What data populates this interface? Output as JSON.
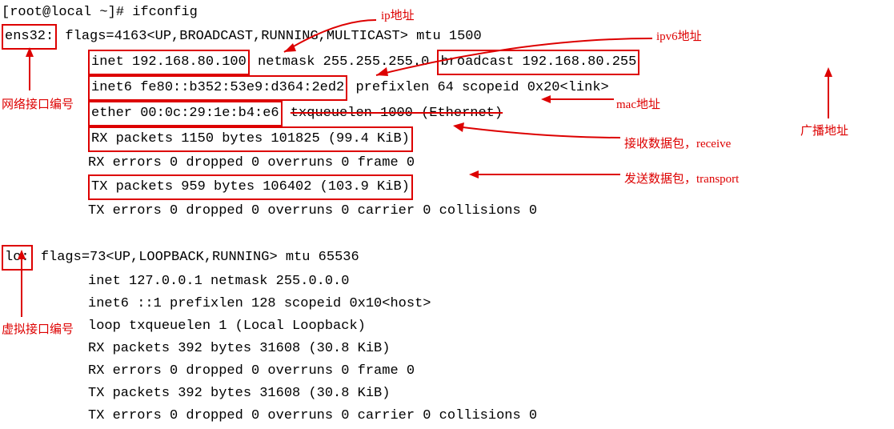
{
  "prompt": "[root@local ~]# ifconfig",
  "ens32": {
    "name": "ens32:",
    "flags": "flags=4163<UP,BROADCAST,RUNNING,MULTICAST>  mtu 1500",
    "inet": "inet 192.168.80.100",
    "netmask": " netmask 255.255.255.0 ",
    "broadcast_prefix": " ",
    "broadcast": "broadcast 192.168.80.255",
    "inet6": "inet6 fe80::b352:53e9:d364:2ed2",
    "inet6_rest": "  prefixlen 64  scopeid 0x20<link>",
    "ether": "ether 00:0c:29:1e:b4:e6",
    "txqueue": "  txqueuelen 1000  (Ethernet)",
    "rx_pkts": "RX packets 1150  bytes 101825 (99.4 KiB)",
    "rx_err": "RX errors 0  dropped 0  overruns 0  frame 0",
    "tx_pkts": "TX packets 959  bytes 106402 (103.9 KiB)",
    "tx_err": "TX errors 0  dropped 0 overruns 0  carrier 0  collisions 0"
  },
  "lo": {
    "name": "lo:",
    "flags": " flags=73<UP,LOOPBACK,RUNNING>  mtu 65536",
    "inet": "inet 127.0.0.1  netmask 255.0.0.0",
    "inet6": "inet6 ::1  prefixlen 128  scopeid 0x10<host>",
    "loop": "loop  txqueuelen 1  (Local Loopback)",
    "rx_pkts": "RX packets 392  bytes 31608 (30.8 KiB)",
    "rx_err": "RX errors 0  dropped 0  overruns 0  frame 0",
    "tx_pkts": "TX packets 392  bytes 31608 (30.8 KiB)",
    "tx_err": "TX errors 0  dropped 0 overruns 0  carrier 0  collisions 0"
  },
  "annotations": {
    "ip_addr": "ip地址",
    "ipv6_addr": "ipv6地址",
    "net_iface_num": "网络接口编号",
    "mac_addr": "mac地址",
    "broadcast_addr": "广播地址",
    "rx_label": "接收数据包，receive",
    "tx_label": "发送数据包，transport",
    "virtual_iface_num": "虚拟接口编号"
  }
}
